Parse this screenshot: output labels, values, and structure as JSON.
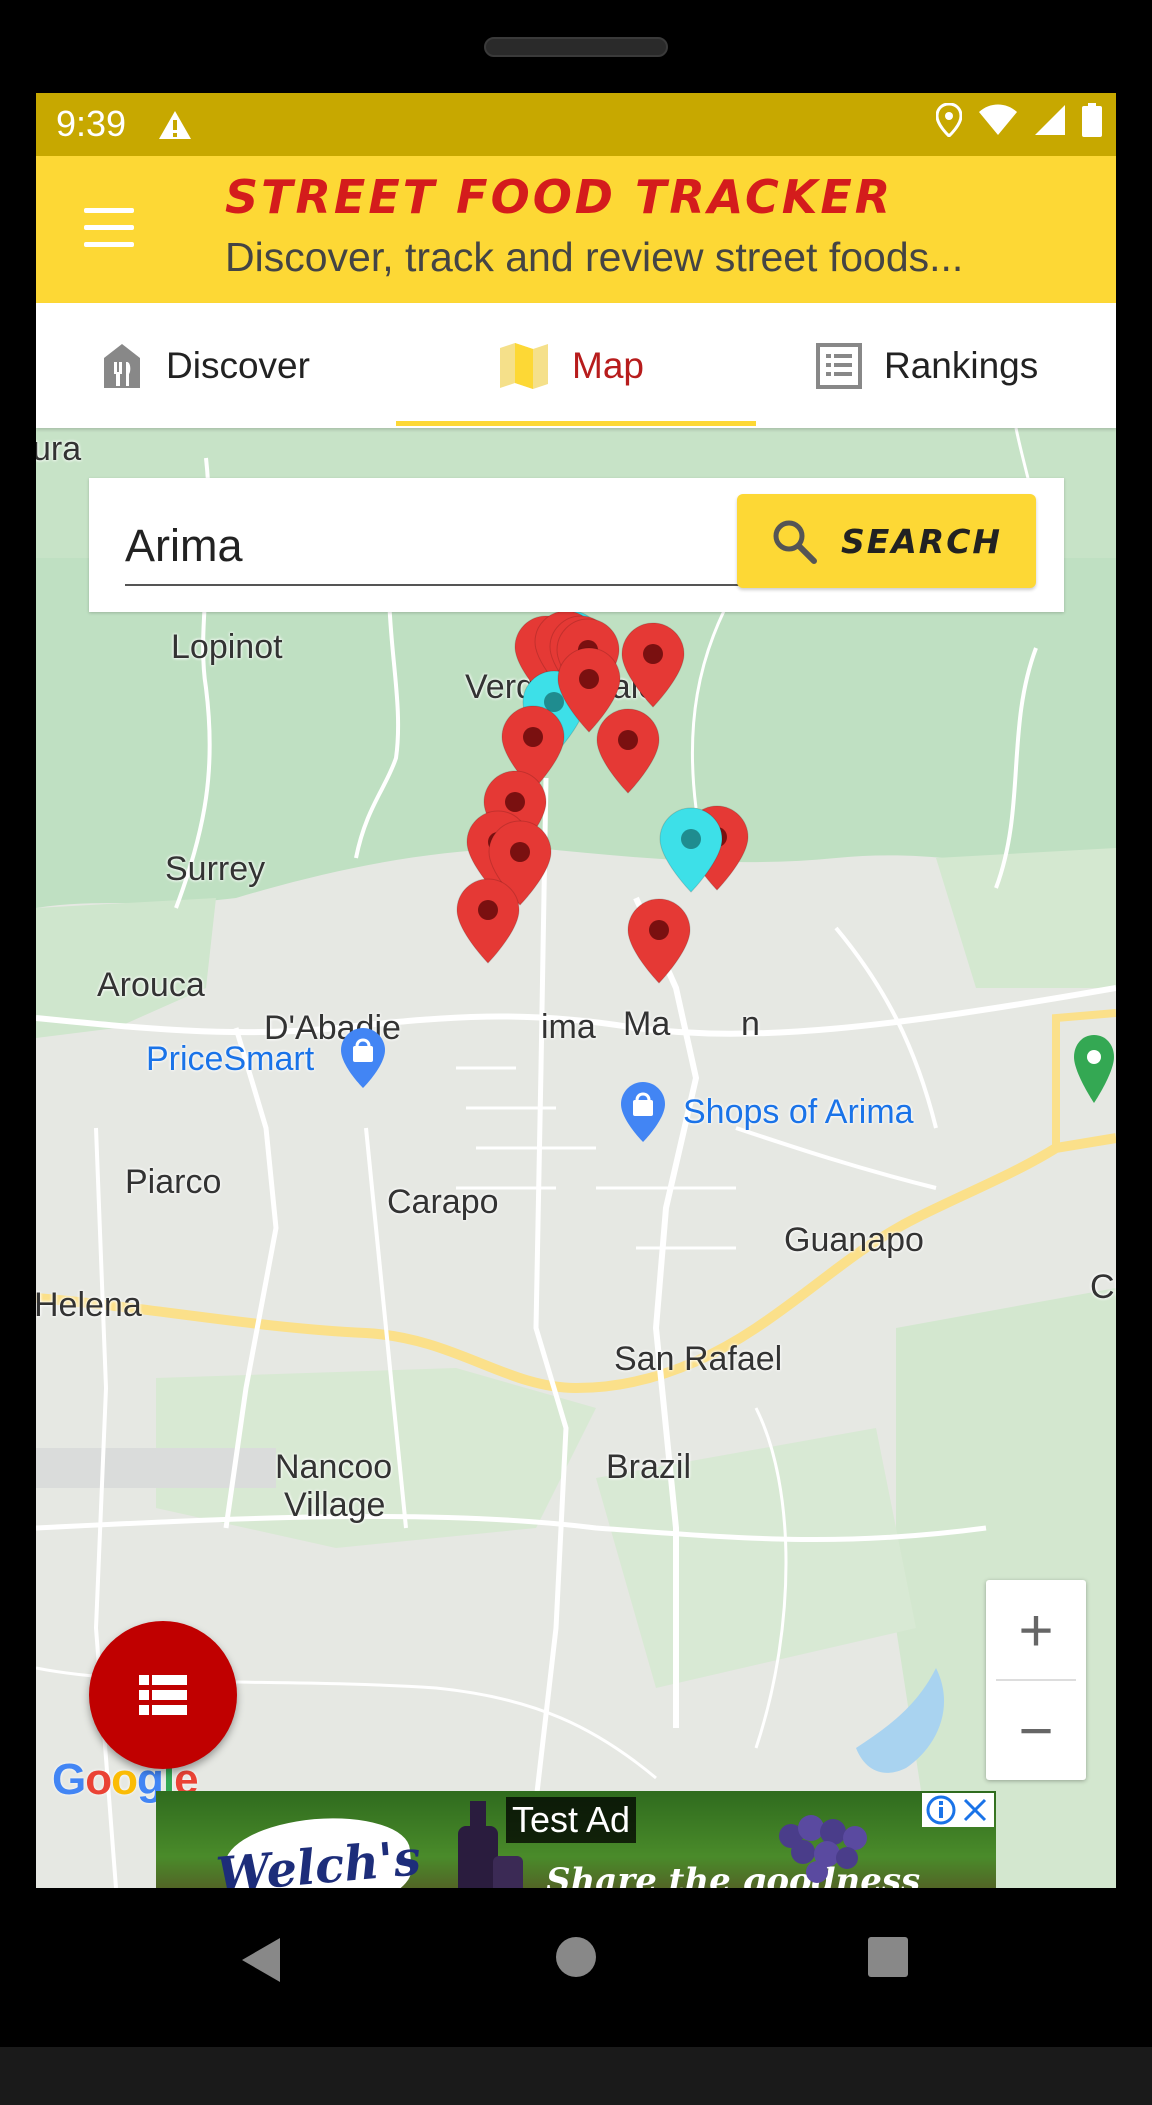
{
  "status_bar": {
    "time": "9:39",
    "icons": [
      "warning-icon",
      "location-icon",
      "wifi-icon",
      "signal-icon",
      "battery-icon"
    ]
  },
  "header": {
    "title": "STREET FOOD TRACKER",
    "subtitle": "Discover, track and review street foods..."
  },
  "tabs": [
    {
      "label": "Discover",
      "icon": "restaurant-icon",
      "active": false
    },
    {
      "label": "Map",
      "icon": "map-icon",
      "active": true
    },
    {
      "label": "Rankings",
      "icon": "list-icon",
      "active": false
    }
  ],
  "search": {
    "value": "Arima",
    "button_label": "SEARCH"
  },
  "map": {
    "places": {
      "ura": "ura",
      "lopinot": "Lopinot",
      "verdant_vale": "Verdant Vale",
      "surrey": "Surrey",
      "arouca": "Arouca",
      "dabadie": "D'Abadie",
      "arima": "ima",
      "malabar_left": "Ma",
      "malabar_right": "n",
      "pricesmart": "PriceSmart",
      "shops_of_arima": "Shops of Arima",
      "piarco": "Piarco",
      "carapo": "Carapo",
      "guanapo": "Guanapo",
      "helena": "Helena",
      "san_rafael": "San Rafael",
      "nancoo": "Nancoo",
      "village": "Village",
      "brazil": "Brazil",
      "cu": "Cu"
    },
    "zoom_in": "+",
    "zoom_out": "−",
    "attribution": "Google"
  },
  "ad": {
    "brand": "Welch's",
    "label": "Test Ad",
    "tagline": "Share the goodness"
  },
  "colors": {
    "status_bar": "#c7a800",
    "header": "#fdd835",
    "title": "#d41c1c",
    "active_tab": "#b71c1c",
    "pin_red": "#e53935",
    "pin_cyan": "#3de0e8",
    "fab": "#c00000"
  }
}
